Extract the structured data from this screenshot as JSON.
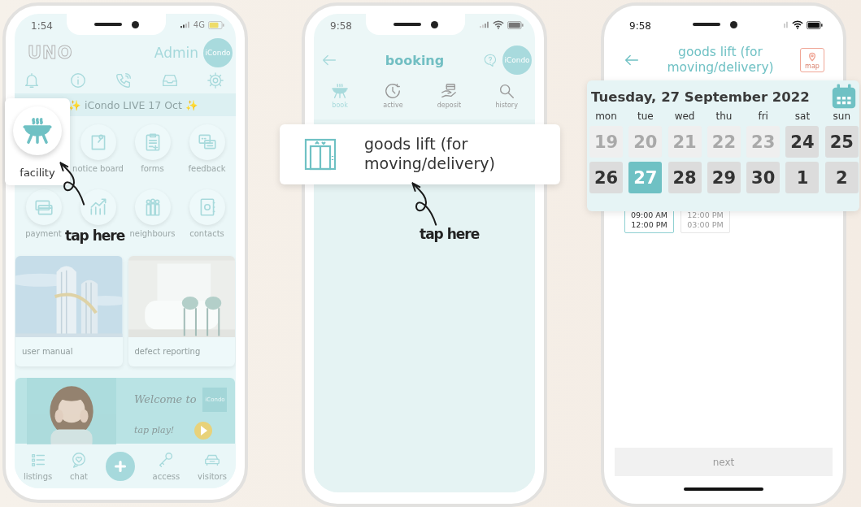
{
  "home_screen": {
    "status_time": "1:54",
    "network": "4G",
    "logo": "UNO",
    "user": "Admin",
    "avatar": "iCondo",
    "announcement": "✨ iCondo LIVE 17 Oct ✨",
    "shortcuts": [
      {
        "kind": "highlighted",
        "label": "facility"
      },
      {
        "kind": "shortcut",
        "label": "notice board"
      },
      {
        "kind": "shortcut",
        "label": "forms"
      },
      {
        "kind": "shortcut",
        "label": "feedback"
      },
      {
        "kind": "shortcut",
        "label": "payment"
      },
      {
        "kind": "covered"
      },
      {
        "kind": "shortcut",
        "label": "neighbours"
      },
      {
        "kind": "shortcut",
        "label": "contacts"
      }
    ],
    "cards": [
      {
        "label": "user manual"
      },
      {
        "label": "defect reporting"
      }
    ],
    "banner": {
      "headline": "Welcome to",
      "logo": "iCondo",
      "cta": "tap play!"
    },
    "nav": [
      {
        "kind": "tab",
        "label": "listings"
      },
      {
        "kind": "tab",
        "label": "chat"
      },
      {
        "kind": "add"
      },
      {
        "kind": "tab",
        "label": "access"
      },
      {
        "kind": "tab",
        "label": "visitors"
      }
    ],
    "hint": "tap here"
  },
  "booking_screen": {
    "status_time": "9:58",
    "title": "booking",
    "avatar": "iCondo",
    "tabs": [
      {
        "label": "book",
        "selected": true
      },
      {
        "label": "active",
        "selected": false
      },
      {
        "label": "deposit",
        "selected": false
      },
      {
        "label": "history",
        "selected": false
      }
    ],
    "facilities": [
      {
        "name": "goods lift (for moving/delivery)",
        "highlighted": true
      }
    ],
    "hint": "tap here"
  },
  "date_screen": {
    "status_time": "9:58",
    "title": "goods lift (for moving/delivery)",
    "map_label": "map",
    "date": "Tuesday, 27 September 2022",
    "weekdays": [
      "mon",
      "tue",
      "wed",
      "thu",
      "fri",
      "sat",
      "sun"
    ],
    "days": [
      {
        "day": "19",
        "disabled": true,
        "selected": false
      },
      {
        "day": "20",
        "disabled": true,
        "selected": false
      },
      {
        "day": "21",
        "disabled": true,
        "selected": false
      },
      {
        "day": "22",
        "disabled": true,
        "selected": false
      },
      {
        "day": "23",
        "disabled": true,
        "selected": false
      },
      {
        "day": "24",
        "disabled": false,
        "selected": false
      },
      {
        "day": "25",
        "disabled": false,
        "selected": false
      },
      {
        "day": "26",
        "disabled": false,
        "selected": false
      },
      {
        "day": "27",
        "disabled": false,
        "selected": true
      },
      {
        "day": "28",
        "disabled": false,
        "selected": false
      },
      {
        "day": "29",
        "disabled": false,
        "selected": false
      },
      {
        "day": "30",
        "disabled": false,
        "selected": false
      },
      {
        "day": "1",
        "disabled": false,
        "selected": false
      },
      {
        "day": "2",
        "disabled": false,
        "selected": false
      }
    ],
    "slots": [
      {
        "start": "09:00 AM",
        "end": "12:00 PM",
        "selected": true,
        "disabled": false
      },
      {
        "start": "12:00 PM",
        "end": "03:00 PM",
        "selected": false,
        "disabled": true
      }
    ],
    "next": {
      "label": "next",
      "disabled": true
    }
  }
}
